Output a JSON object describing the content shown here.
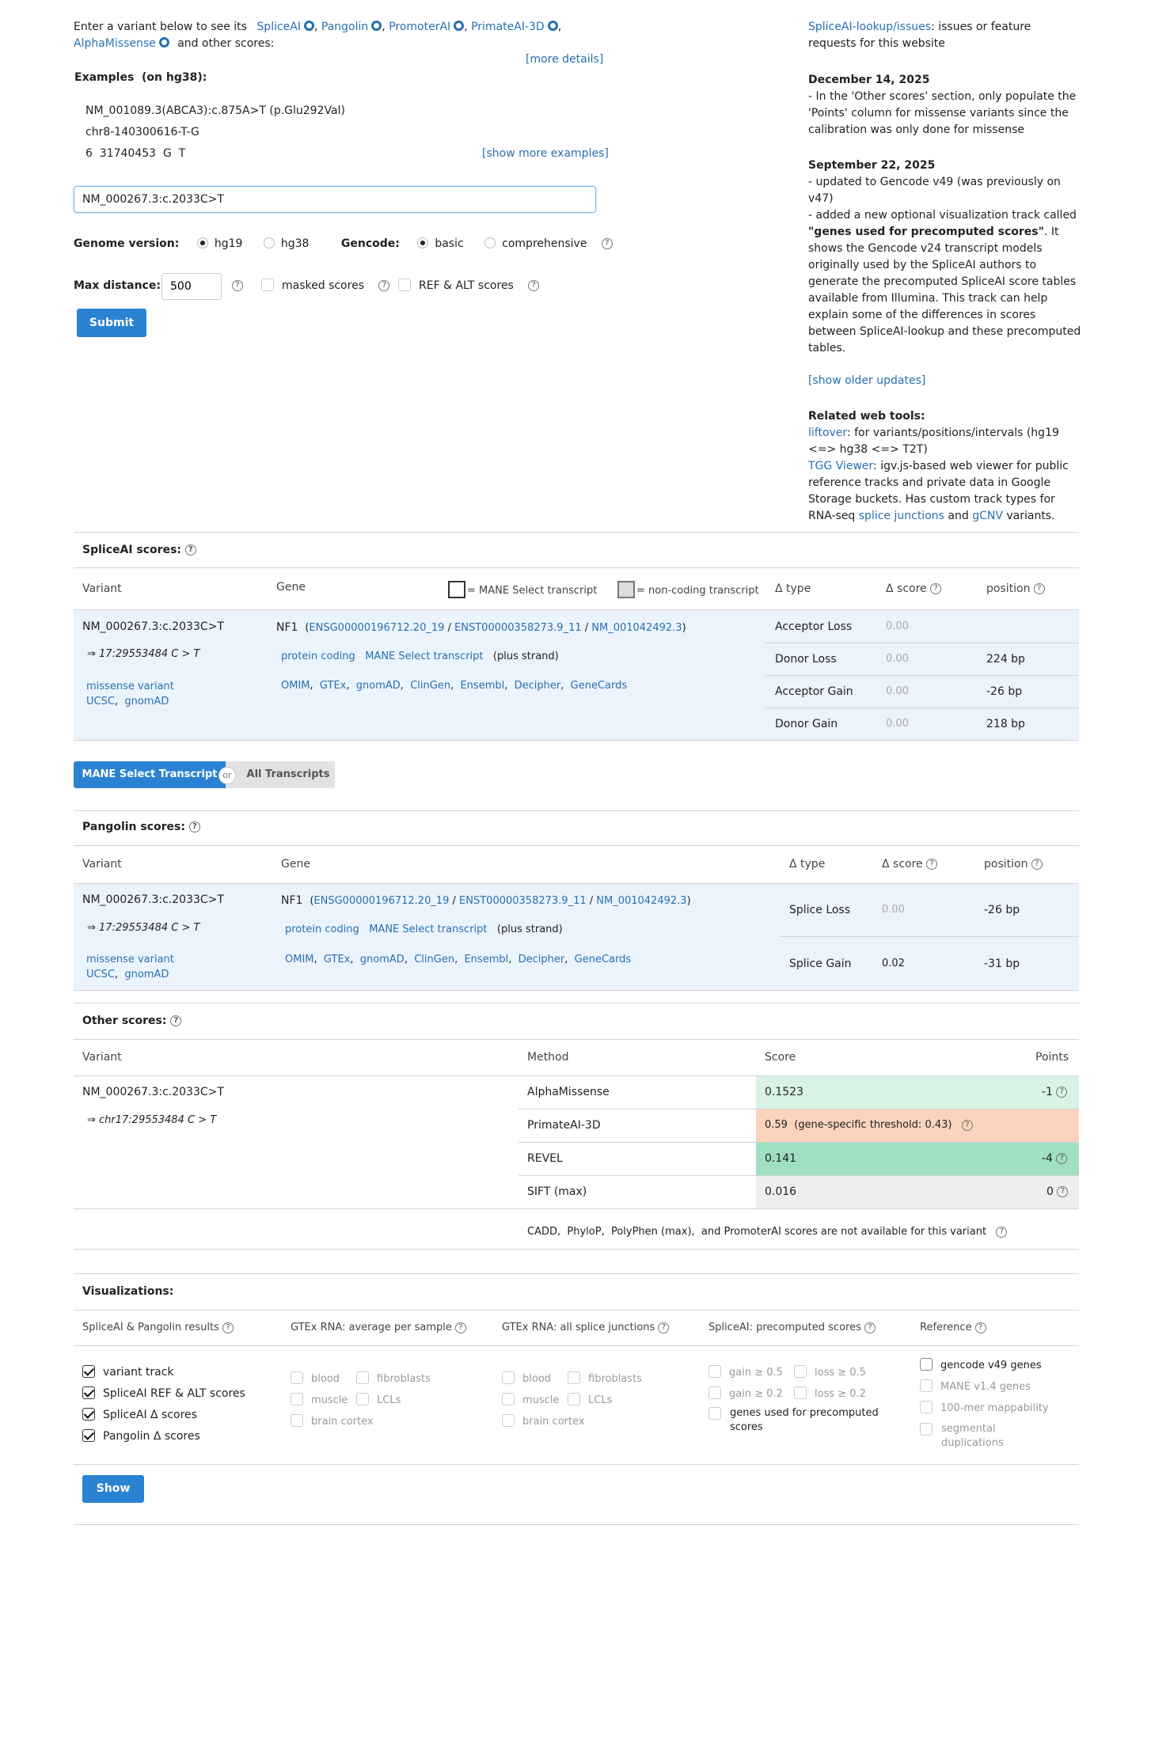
{
  "intro": {
    "prefix": "Enter a variant below to see its",
    "tools": [
      "SpliceAI",
      "Pangolin",
      "PromoterAI",
      "PrimateAI-3D",
      "AlphaMissense"
    ],
    "suffix": "and other scores:",
    "more_details": "[more details]"
  },
  "examples": {
    "title": "Examples",
    "build": "(on hg38):",
    "items": [
      "NM_001089.3(ABCA3):c.875A>T (p.Glu292Val)",
      "chr8-140300616-T-G",
      "6  31740453  G  T"
    ],
    "show_more": "[show more examples]"
  },
  "search": {
    "value": "NM_000267.3:c.2033C>T"
  },
  "options": {
    "genome_label": "Genome version:",
    "genome_options": [
      "hg19",
      "hg38"
    ],
    "gencode_label": "Gencode:",
    "gencode_options": [
      "basic",
      "comprehensive"
    ],
    "maxdist_label": "Max distance:",
    "maxdist_value": "500",
    "masked": "masked scores",
    "refalt": "REF & ALT scores",
    "submit": "Submit"
  },
  "news": {
    "issues_link": "SpliceAI-lookup/issues",
    "issues_text": ": issues or feature requests for this website",
    "u1_date": "December 14, 2025",
    "u1_text": "- In the 'Other scores' section, only populate the 'Points' column for missense variants since the calibration was only done for missense",
    "u2_date": "September 22, 2025",
    "u2_l1": "- updated to Gencode v49 (was previously on v47)",
    "u2_l2a": "- added a new optional visualization track called ",
    "u2_l2b": "\"genes used for precomputed scores\"",
    "u2_l2c": ". It shows the Gencode v24 transcript models originally used by the SpliceAI authors to generate the precomputed SpliceAI score tables available from Illumina. This track can help explain some of the differences in scores between SpliceAI-lookup and these precomputed tables.",
    "show_older": "[show older updates]",
    "related_title": "Related web tools:",
    "liftover": "liftover",
    "liftover_text": ": for variants/positions/intervals (hg19 <=> hg38 <=> T2T)",
    "tgg": "TGG Viewer",
    "tgg_text": ": igv.js-based web viewer for public reference tracks and private data in Google Storage buckets. Has custom track types for RNA-seq ",
    "splice_junctions": "splice junctions",
    "and": " and ",
    "gcnv": "gCNV",
    "variants": " variants."
  },
  "spliceai": {
    "title": "SpliceAI scores:",
    "h_variant": "Variant",
    "h_gene": "Gene",
    "mane_legend": "= MANE Select transcript",
    "noncoding_legend": "= non-coding transcript",
    "h_type": "Δ type",
    "h_score": "Δ score",
    "h_pos": "position",
    "variant": "NM_000267.3:c.2033C>T",
    "coord": "⇒ 17:29553484 C > T",
    "consequence": "missense variant",
    "ucsc": "UCSC",
    "gnomad": "gnomAD",
    "gene": "NF1",
    "ensg": "ENSG00000196712.20_19",
    "enst": "ENST00000358273.9_11",
    "nm": "NM_001042492.3",
    "biotype": "protein coding",
    "mane": "MANE Select transcript",
    "strand": "(plus strand)",
    "links": [
      "OMIM",
      "GTEx",
      "gnomAD",
      "ClinGen",
      "Ensembl",
      "Decipher",
      "GeneCards"
    ],
    "rows": [
      {
        "type": "Acceptor Loss",
        "score": "0.00",
        "pos": ""
      },
      {
        "type": "Donor Loss",
        "score": "0.00",
        "pos": "224 bp"
      },
      {
        "type": "Acceptor Gain",
        "score": "0.00",
        "pos": "-26 bp"
      },
      {
        "type": "Donor Gain",
        "score": "0.00",
        "pos": "218 bp"
      }
    ]
  },
  "toggle": {
    "mane": "MANE Select Transcript",
    "or": "or",
    "all": "All Transcripts"
  },
  "pangolin": {
    "title": "Pangolin scores:",
    "h_variant": "Variant",
    "h_gene": "Gene",
    "h_type": "Δ type",
    "h_score": "Δ score",
    "h_pos": "position",
    "variant": "NM_000267.3:c.2033C>T",
    "coord": "⇒ 17:29553484 C > T",
    "consequence": "missense variant",
    "ucsc": "UCSC",
    "gnomad": "gnomAD",
    "gene": "NF1",
    "ensg": "ENSG00000196712.20_19",
    "enst": "ENST00000358273.9_11",
    "nm": "NM_001042492.3",
    "biotype": "protein coding",
    "mane": "MANE Select transcript",
    "strand": "(plus strand)",
    "links": [
      "OMIM",
      "GTEx",
      "gnomAD",
      "ClinGen",
      "Ensembl",
      "Decipher",
      "GeneCards"
    ],
    "rows": [
      {
        "type": "Splice Loss",
        "score": "0.00",
        "pos": "-26 bp"
      },
      {
        "type": "Splice Gain",
        "score": "0.02",
        "pos": "-31 bp"
      }
    ]
  },
  "other": {
    "title": "Other scores:",
    "h_variant": "Variant",
    "h_method": "Method",
    "h_score": "Score",
    "h_points": "Points",
    "variant": "NM_000267.3:c.2033C>T",
    "coord": "⇒ chr17:29553484 C > T",
    "rows": [
      {
        "method": "AlphaMissense",
        "score": "0.1523",
        "points": "-1",
        "color": "#d9f2e6"
      },
      {
        "method": "PrimateAI-3D",
        "score": "0.59  (gene-specific threshold: 0.43)",
        "points": "",
        "color": "#fbd3bd"
      },
      {
        "method": "REVEL",
        "score": "0.141",
        "points": "-4",
        "color": "#9fe0c1"
      },
      {
        "method": "SIFT (max)",
        "score": "0.016",
        "points": "0",
        "color": "#eeeeee"
      }
    ],
    "not_available": "CADD,  PhyloP,  PolyPhen (max),  and PromoterAI scores are not available for this variant"
  },
  "viz": {
    "title": "Visualizations:",
    "h1": "SpliceAI & Pangolin results",
    "h2": "GTEx RNA: average per sample",
    "h3": "GTEx RNA: all splice junctions",
    "h4": "SpliceAI: precomputed scores",
    "h5": "Reference",
    "c1": [
      "variant track",
      "SpliceAI REF & ALT scores",
      "SpliceAI Δ  scores",
      "Pangolin Δ  scores"
    ],
    "c2a": [
      "blood",
      "muscle",
      "brain cortex"
    ],
    "c2b": [
      "fibroblasts",
      "LCLs"
    ],
    "c3a": [
      "blood",
      "muscle",
      "brain cortex"
    ],
    "c3b": [
      "fibroblasts",
      "LCLs"
    ],
    "c4a": [
      "gain ≥ 0.5",
      "gain ≥ 0.2"
    ],
    "c4b": [
      "loss ≥ 0.5",
      "loss ≥ 0.2"
    ],
    "c4c": "genes used for precomputed scores",
    "c5": [
      "gencode v49 genes",
      "MANE v1.4 genes",
      "100-mer mappability",
      "segmental duplications"
    ],
    "show": "Show"
  },
  "colors": {
    "accent": "#2a83d2",
    "link": "#2a6fb0",
    "row_bg": "#ebf3fd"
  }
}
